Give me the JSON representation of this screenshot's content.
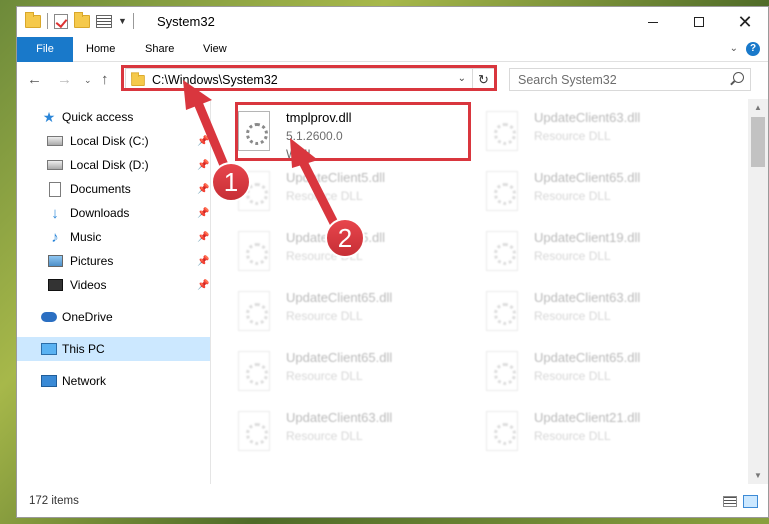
{
  "window": {
    "title": "System32",
    "quick_access_toolbar": [
      "folder-icon",
      "properties-check-icon",
      "new-folder-icon",
      "properties-list-icon",
      "customize-dropdown-icon"
    ]
  },
  "ribbon": {
    "tabs": [
      {
        "label": "File",
        "active": true
      },
      {
        "label": "Home"
      },
      {
        "label": "Share"
      },
      {
        "label": "View"
      }
    ],
    "help_label": "?"
  },
  "address_bar": {
    "path": "C:\\Windows\\System32",
    "search_placeholder": "Search System32"
  },
  "nav_pane": {
    "items": [
      {
        "label": "Quick access",
        "icon": "star-icon",
        "level": 0
      },
      {
        "label": "Local Disk (C:)",
        "icon": "disk-icon",
        "level": 1,
        "pinned": true
      },
      {
        "label": "Local Disk (D:)",
        "icon": "disk-icon",
        "level": 1,
        "pinned": true
      },
      {
        "label": "Documents",
        "icon": "documents-icon",
        "level": 1,
        "pinned": true
      },
      {
        "label": "Downloads",
        "icon": "downloads-icon",
        "level": 1,
        "pinned": true
      },
      {
        "label": "Music",
        "icon": "music-icon",
        "level": 1,
        "pinned": true
      },
      {
        "label": "Pictures",
        "icon": "pictures-icon",
        "level": 1,
        "pinned": true
      },
      {
        "label": "Videos",
        "icon": "videos-icon",
        "level": 1,
        "pinned": true
      },
      {
        "label": "OneDrive",
        "icon": "onedrive-icon",
        "level": 0
      },
      {
        "label": "This PC",
        "icon": "this-pc-icon",
        "level": 0,
        "selected": true
      },
      {
        "label": "Network",
        "icon": "network-icon",
        "level": 0
      }
    ]
  },
  "files": [
    {
      "name": "tmplprov.dll",
      "line2": "5.1.2600.0",
      "line3": "WMI",
      "highlighted": true
    },
    {
      "name": "UpdateClient63.dll",
      "line2": "Resource DLL"
    },
    {
      "name": "UpdateClient5.dll",
      "line2": "Resource DLL"
    },
    {
      "name": "UpdateClient65.dll",
      "line2": "Resource DLL"
    },
    {
      "name": "UpdateClient5.dll",
      "line2": "Resource DLL"
    },
    {
      "name": "UpdateClient19.dll",
      "line2": "Resource DLL"
    },
    {
      "name": "UpdateClient65.dll",
      "line2": "Resource DLL"
    },
    {
      "name": "UpdateClient63.dll",
      "line2": "Resource DLL"
    },
    {
      "name": "UpdateClient65.dll",
      "line2": "Resource DLL"
    },
    {
      "name": "UpdateClient65.dll",
      "line2": "Resource DLL"
    },
    {
      "name": "UpdateClient63.dll",
      "line2": "Resource DLL"
    },
    {
      "name": "UpdateClient21.dll",
      "line2": "Resource DLL"
    }
  ],
  "status_bar": {
    "item_count": "172 items"
  },
  "annotations": {
    "color": "#d9363e",
    "steps": [
      "1",
      "2"
    ]
  }
}
